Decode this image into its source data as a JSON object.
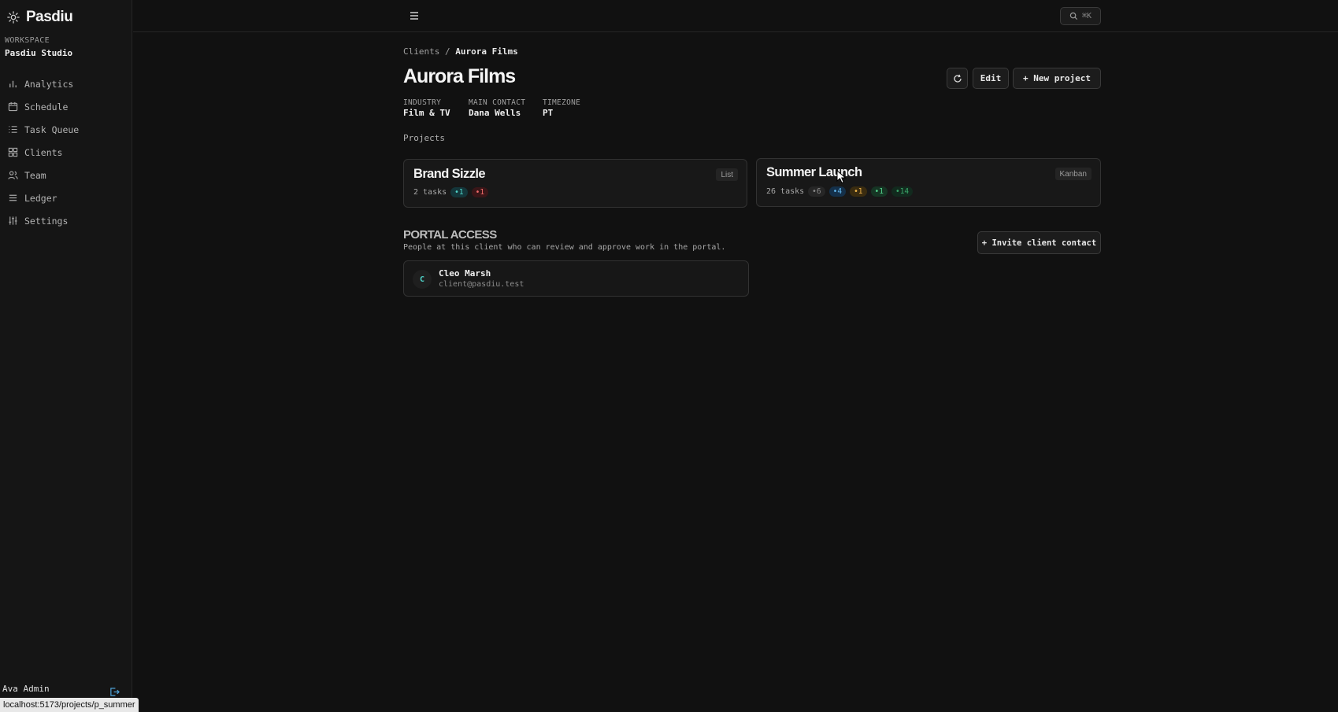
{
  "app": {
    "name": "Pasdiu"
  },
  "workspace": {
    "label": "WORKSPACE",
    "name": "Pasdiu Studio"
  },
  "nav": [
    {
      "label": "Analytics",
      "icon": "bar-chart-icon"
    },
    {
      "label": "Schedule",
      "icon": "calendar-icon"
    },
    {
      "label": "Task Queue",
      "icon": "list-icon"
    },
    {
      "label": "Clients",
      "icon": "grid-icon"
    },
    {
      "label": "Team",
      "icon": "users-icon"
    },
    {
      "label": "Ledger",
      "icon": "ledger-icon"
    },
    {
      "label": "Settings",
      "icon": "sliders-icon"
    }
  ],
  "user": {
    "name": "Ava Admin"
  },
  "topbar": {
    "search_shortcut": "⌘K"
  },
  "breadcrumb": {
    "parent": "Clients",
    "separator": "/",
    "current": "Aurora Films"
  },
  "client": {
    "name": "Aurora Films",
    "meta": [
      {
        "label": "INDUSTRY",
        "value": "Film & TV"
      },
      {
        "label": "MAIN CONTACT",
        "value": "Dana Wells"
      },
      {
        "label": "TIMEZONE",
        "value": "PT"
      }
    ]
  },
  "actions": {
    "edit": "Edit",
    "new_project": "+ New project"
  },
  "projects_label": "Projects",
  "projects": [
    {
      "title": "Brand Sizzle",
      "view": "List",
      "tasks": "2 tasks",
      "counts": [
        {
          "value": "•1",
          "color": "#4fd3c8"
        },
        {
          "value": "•1",
          "color": "#f06a6a"
        }
      ]
    },
    {
      "title": "Summer Launch",
      "view": "Kanban",
      "tasks": "26 tasks",
      "counts": [
        {
          "value": "•6",
          "color": "#8a8a8a"
        },
        {
          "value": "•4",
          "color": "#62b8f0"
        },
        {
          "value": "•1",
          "color": "#f0b54a"
        },
        {
          "value": "•1",
          "color": "#52d18a"
        },
        {
          "value": "•14",
          "color": "#3aa86a"
        }
      ]
    }
  ],
  "portal": {
    "title": "PORTAL ACCESS",
    "subtitle": "People at this client who can review and approve work in the portal.",
    "invite": "+ Invite client contact",
    "contacts": [
      {
        "initial": "C",
        "name": "Cleo Marsh",
        "email": "client@pasdiu.test"
      }
    ]
  },
  "status_url": "localhost:5173/projects/p_summer"
}
